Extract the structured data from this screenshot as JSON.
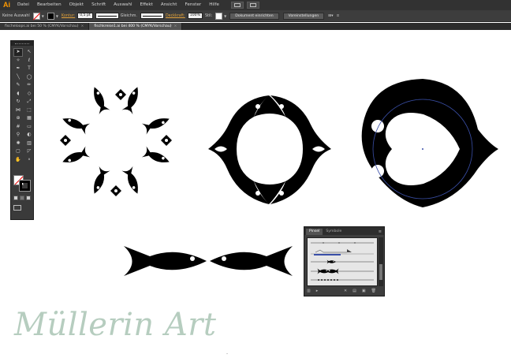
{
  "app": {
    "logo": "Ai"
  },
  "menubar": {
    "items": [
      "Datei",
      "Bearbeiten",
      "Objekt",
      "Schrift",
      "Auswahl",
      "Effekt",
      "Ansicht",
      "Fenster",
      "Hilfe"
    ]
  },
  "controlbar": {
    "selection_label": "Keine Auswahl",
    "stroke_link": "Kontur:",
    "stroke_weight": "0,5 pt",
    "stroke_profile": "Gleichm.",
    "opacity_link": "Deckkraft:",
    "opacity_value": "100%",
    "style_label": "Stil:",
    "doc_setup_button": "Dokument einrichten",
    "preferences_button": "Voreinstellungen"
  },
  "tabs": [
    {
      "label": "fischeloops.ai bei 50 % (CMYK/Vorschau)"
    },
    {
      "label": "fischkreise1.ai bei 400 % (CMYK/Vorschau)"
    }
  ],
  "brush_panel": {
    "tabs": [
      "Pinsel",
      "Symbole"
    ],
    "menu_icon": "panel-menu-icon"
  },
  "watermark": "Müllerin Art",
  "colors": {
    "ui_dark": "#323232",
    "accent_orange": "#ff9a00",
    "link_orange": "#e3a23a",
    "guide_blue": "#3a4fa8",
    "watermark": "#b6cdbf"
  }
}
